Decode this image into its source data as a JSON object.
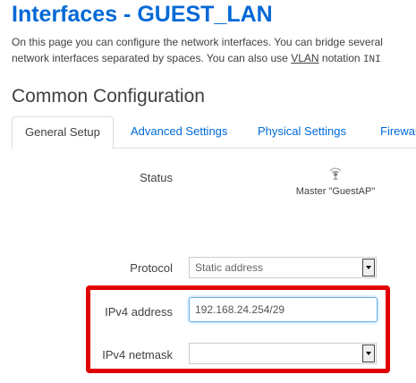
{
  "page": {
    "title": "Interfaces - GUEST_LAN",
    "description_line1": "On this page you can configure the network interfaces. You can bridge several",
    "description_line2_prefix": "network interfaces separated by spaces. You can also use ",
    "description_line2_abbr": "VLAN",
    "description_line2_mid": " notation ",
    "description_line2_code": "INI"
  },
  "section": {
    "title": "Common Configuration",
    "tabs": [
      {
        "label": "General Setup",
        "active": true
      },
      {
        "label": "Advanced Settings",
        "active": false
      },
      {
        "label": "Physical Settings",
        "active": false
      },
      {
        "label": "Firewal",
        "active": false
      }
    ]
  },
  "form": {
    "status": {
      "label": "Status",
      "icon": "wifi-signal-icon",
      "value": "Master \"GuestAP\""
    },
    "protocol": {
      "label": "Protocol",
      "selected": "Static address"
    },
    "ipv4_address": {
      "label": "IPv4 address",
      "value": "192.168.24.254/29"
    },
    "ipv4_netmask": {
      "label": "IPv4 netmask",
      "selected": ""
    }
  },
  "colors": {
    "title": "#0069d6",
    "link": "#0069d6",
    "highlight": "#e00000"
  }
}
